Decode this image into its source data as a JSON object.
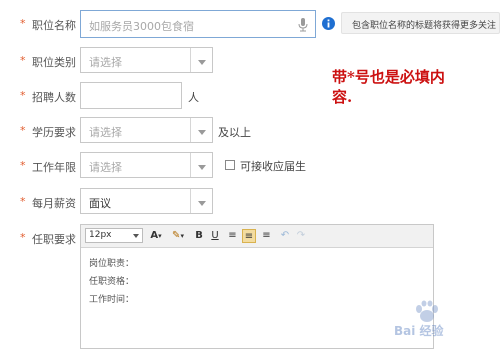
{
  "required_mark": "*",
  "fields": {
    "job_title": {
      "label": "职位名称",
      "placeholder": "如服务员3000包食宿",
      "tip": "包含职位名称的标题将获得更多关注"
    },
    "job_category": {
      "label": "职位类别",
      "placeholder": "请选择"
    },
    "headcount": {
      "label": "招聘人数",
      "value": "",
      "unit": "人"
    },
    "education": {
      "label": "学历要求",
      "placeholder": "请选择",
      "suffix": "及以上"
    },
    "experience": {
      "label": "工作年限",
      "placeholder": "请选择",
      "checkbox_label": "可接收应届生"
    },
    "salary": {
      "label": "每月薪资",
      "value": "面议"
    },
    "requirements": {
      "label": "任职要求",
      "font_size": "12px",
      "lines": [
        "岗位职责：",
        "任职资格：",
        "工作时间："
      ]
    }
  },
  "annotation": {
    "line1": "带*号也是必填内",
    "line2": "容."
  },
  "watermark": "Bai 经验",
  "colors": {
    "required": "#e25c2e",
    "annotation": "#cc1111",
    "tip_icon": "#1f6fd1"
  }
}
